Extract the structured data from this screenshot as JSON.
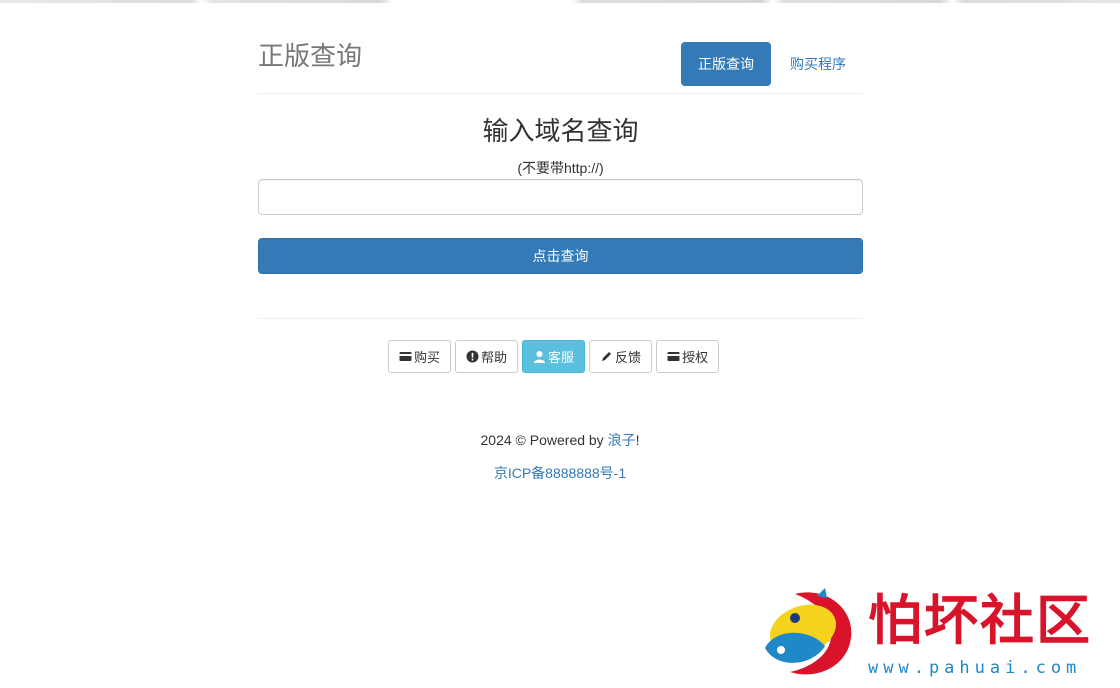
{
  "header": {
    "brand": "正版查询",
    "nav": [
      {
        "label": "正版查询",
        "active": true
      },
      {
        "label": "购买程序",
        "active": false
      }
    ]
  },
  "form": {
    "title": "输入域名查询",
    "hint": "(不要带http://)",
    "input_value": "",
    "input_placeholder": "",
    "submit_label": "点击查询"
  },
  "buttons": [
    {
      "label": "购买",
      "icon": "card-icon",
      "style": "default"
    },
    {
      "label": "帮助",
      "icon": "exclamation-circle-icon",
      "style": "default"
    },
    {
      "label": "客服",
      "icon": "user-icon",
      "style": "info"
    },
    {
      "label": "反馈",
      "icon": "pencil-icon",
      "style": "default"
    },
    {
      "label": "授权",
      "icon": "card-icon",
      "style": "default"
    }
  ],
  "footer": {
    "prefix": "2024 © Powered by ",
    "author": "浪子",
    "suffix": "!",
    "icp": "京ICP备8888888号-1"
  },
  "watermark": {
    "text": "怕坏社区",
    "url": "www.pahuai.com"
  },
  "colors": {
    "primary": "#337ab7",
    "info": "#5bc0de",
    "brand_gray": "#777777",
    "watermark_red": "#d9132a",
    "watermark_blue": "#1e88c8"
  }
}
